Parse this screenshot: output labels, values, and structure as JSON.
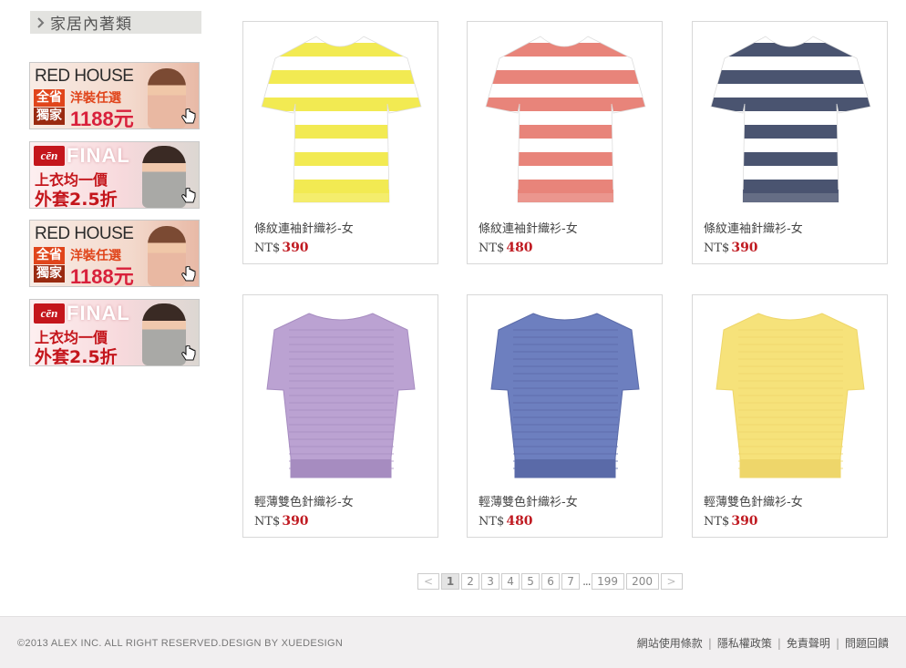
{
  "sidebar": {
    "header_title": "家居內著類",
    "banners": [
      {
        "brand": "RED HOUSE",
        "badge1": "全省",
        "badge2": "獨家",
        "sub": "洋裝任選",
        "price": "1188元"
      },
      {
        "brand": "FINAL",
        "logo": "cēn",
        "line1": "上衣均一價",
        "line2": "外套2.5折"
      },
      {
        "brand": "RED HOUSE",
        "badge1": "全省",
        "badge2": "獨家",
        "sub": "洋裝任選",
        "price": "1188元"
      },
      {
        "brand": "FINAL",
        "logo": "cēn",
        "line1": "上衣均一價",
        "line2": "外套2.5折"
      }
    ]
  },
  "products": [
    {
      "name": "條紋連袖針織衫-女",
      "currency": "NT$",
      "price": "390",
      "style": "stripe",
      "c1": "#f2ea52",
      "c2": "#ffffff"
    },
    {
      "name": "條紋連袖針織衫-女",
      "currency": "NT$",
      "price": "480",
      "style": "stripe",
      "c1": "#e8847a",
      "c2": "#ffffff"
    },
    {
      "name": "條紋連袖針織衫-女",
      "currency": "NT$",
      "price": "390",
      "style": "stripe",
      "c1": "#4a5470",
      "c2": "#ffffff"
    },
    {
      "name": "輕薄雙色針織衫-女",
      "currency": "NT$",
      "price": "390",
      "style": "knit",
      "c1": "#bba2d2",
      "c2": "#a68cc0"
    },
    {
      "name": "輕薄雙色針織衫-女",
      "currency": "NT$",
      "price": "480",
      "style": "knit",
      "c1": "#6d7fbf",
      "c2": "#5a6aa8"
    },
    {
      "name": "輕薄雙色針織衫-女",
      "currency": "NT$",
      "price": "390",
      "style": "knit",
      "c1": "#f6e27a",
      "c2": "#eed66a"
    }
  ],
  "pagination": {
    "prev": "<",
    "pages": [
      "1",
      "2",
      "3",
      "4",
      "5",
      "6",
      "7"
    ],
    "ellipsis": "...",
    "tail": [
      "199",
      "200"
    ],
    "next": ">"
  },
  "footer": {
    "copyright": "©2013 ALEX INC. ALL RIGHT RESERVED.DESIGN BY XUEDESIGN",
    "links": [
      "網站使用條款",
      "隱私權政策",
      "免責聲明",
      "問題回饋"
    ],
    "separator": "|"
  },
  "colors": {
    "price_red": "#c01b22",
    "footer_bg": "#f1eff0"
  }
}
